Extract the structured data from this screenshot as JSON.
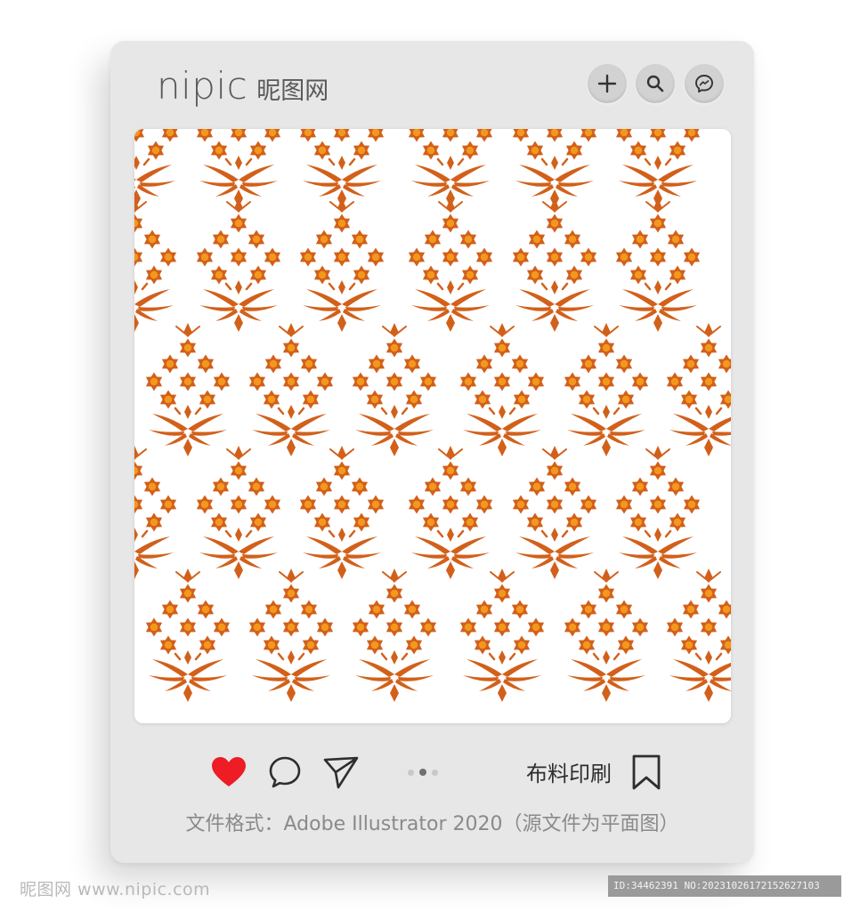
{
  "header": {
    "brand_name": "nipic",
    "brand_cn": "昵图网",
    "buttons": [
      {
        "icon": "plus-icon"
      },
      {
        "icon": "search-icon"
      },
      {
        "icon": "messenger-icon"
      }
    ]
  },
  "image": {
    "description_colors": {
      "dark": "#d2601a",
      "light": "#f3981d",
      "background": "#ffffff"
    }
  },
  "actions": {
    "like_icon": "heart-icon",
    "like_color": "#ee1c24",
    "comment_icon": "comment-icon",
    "share_icon": "send-icon",
    "pagination_total": 3,
    "pagination_active": 2,
    "tag_label": "布料印刷",
    "bookmark_icon": "bookmark-icon"
  },
  "caption": "文件格式：Adobe Illustrator 2020（源文件为平面图）",
  "watermark": {
    "left": "昵图网 www.nipic.com",
    "right": "ID:34462391 NO:20231026172152627103"
  },
  "colors": {
    "card": "#e7e7e7",
    "text": "#5a5a5a"
  }
}
